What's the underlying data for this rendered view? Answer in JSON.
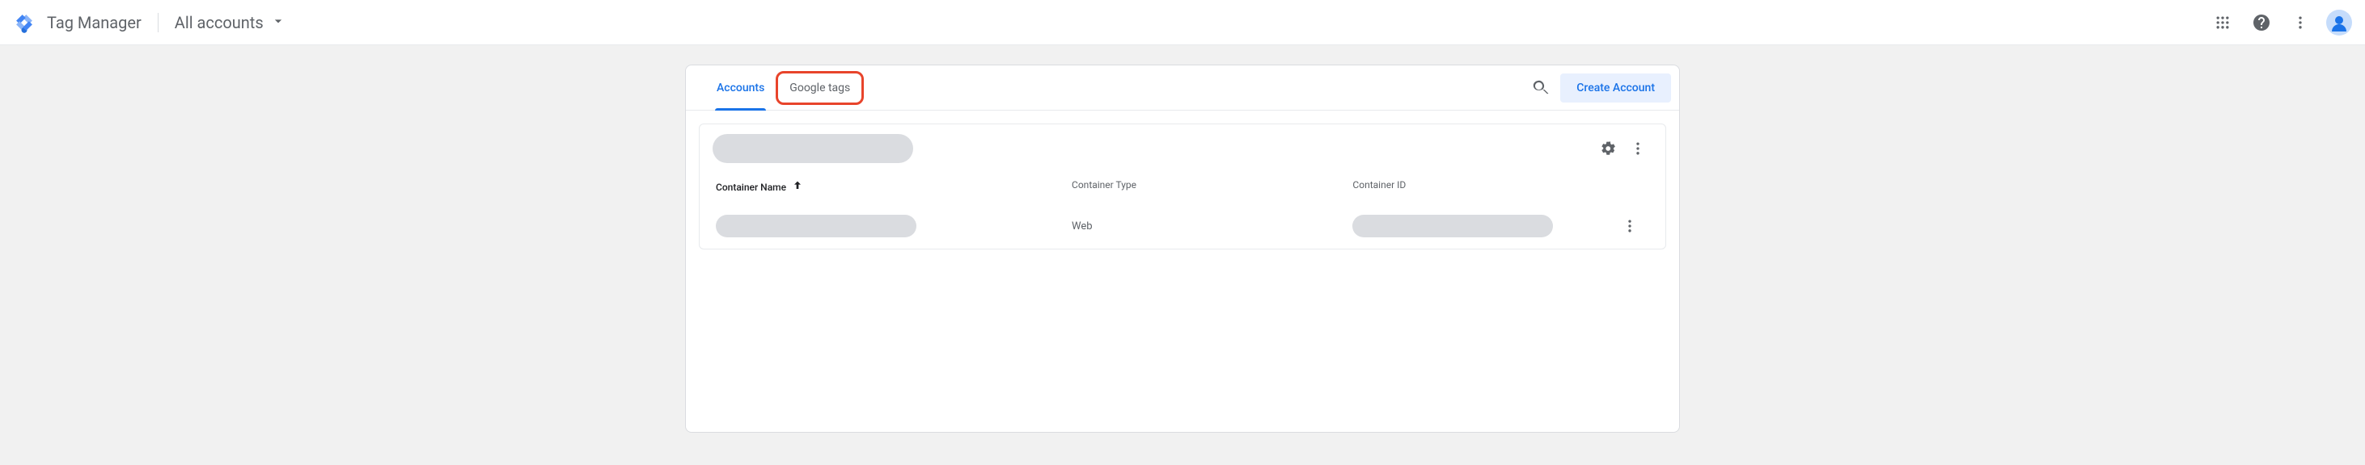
{
  "header": {
    "product_name": "Tag Manager",
    "breadcrumb_label": "All accounts"
  },
  "tabs": {
    "accounts_label": "Accounts",
    "google_tags_label": "Google tags"
  },
  "actions": {
    "create_account_label": "Create Account"
  },
  "table": {
    "columns": {
      "container_name": "Container Name",
      "container_type": "Container Type",
      "container_id": "Container ID"
    },
    "rows": [
      {
        "type": "Web"
      }
    ]
  },
  "icons": {
    "apps": "apps-icon",
    "help": "help-icon",
    "overflow": "more-vert-icon",
    "avatar": "avatar-icon",
    "search": "search-icon",
    "gear": "gear-icon",
    "chevron_down": "chevron-down-icon",
    "sort_up": "arrow-up-icon"
  },
  "colors": {
    "primary": "#1a73e8",
    "primary_container": "#e8f0fe",
    "text_secondary": "#5f6368",
    "highlight_border": "#e8442b",
    "page_bg": "#f1f1f1",
    "redacted": "#dadce0"
  }
}
